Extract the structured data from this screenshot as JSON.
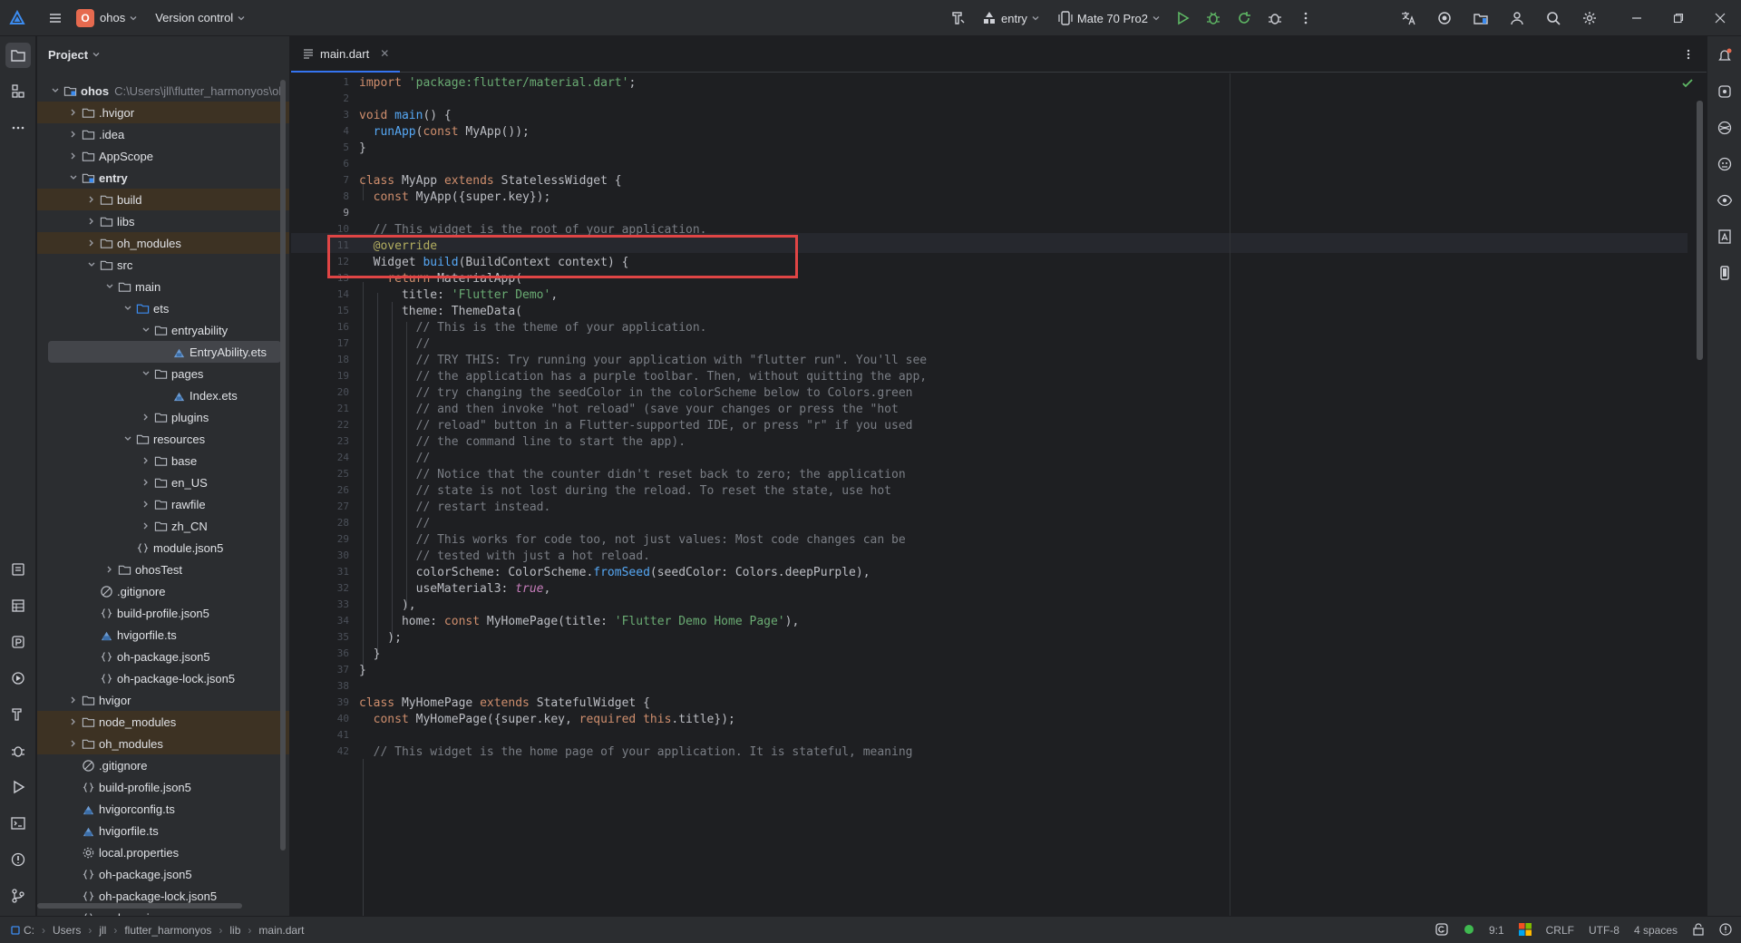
{
  "titlebar": {
    "project_badge": "O",
    "project_name": "ohos",
    "vcs_label": "Version control",
    "run_config": "entry",
    "device": "Mate 70 Pro2"
  },
  "project_panel": {
    "title": "Project",
    "root_name": "ohos",
    "root_path": "C:\\Users\\jll\\flutter_harmonyos\\oh",
    "items": [
      {
        "label": ".hvigor"
      },
      {
        "label": ".idea"
      },
      {
        "label": "AppScope"
      },
      {
        "label": "entry"
      },
      {
        "label": "build"
      },
      {
        "label": "libs"
      },
      {
        "label": "oh_modules"
      },
      {
        "label": "src"
      },
      {
        "label": "main"
      },
      {
        "label": "ets"
      },
      {
        "label": "entryability"
      },
      {
        "label": "EntryAbility.ets"
      },
      {
        "label": "pages"
      },
      {
        "label": "Index.ets"
      },
      {
        "label": "plugins"
      },
      {
        "label": "resources"
      },
      {
        "label": "base"
      },
      {
        "label": "en_US"
      },
      {
        "label": "rawfile"
      },
      {
        "label": "zh_CN"
      },
      {
        "label": "module.json5"
      },
      {
        "label": "ohosTest"
      },
      {
        "label": ".gitignore"
      },
      {
        "label": "build-profile.json5"
      },
      {
        "label": "hvigorfile.ts"
      },
      {
        "label": "oh-package.json5"
      },
      {
        "label": "oh-package-lock.json5"
      },
      {
        "label": "hvigor"
      },
      {
        "label": "node_modules"
      },
      {
        "label": "oh_modules"
      },
      {
        "label": ".gitignore"
      },
      {
        "label": "build-profile.json5"
      },
      {
        "label": "hvigorconfig.ts"
      },
      {
        "label": "hvigorfile.ts"
      },
      {
        "label": "local.properties"
      },
      {
        "label": "oh-package.json5"
      },
      {
        "label": "oh-package-lock.json5"
      },
      {
        "label": "package.json"
      }
    ]
  },
  "editor": {
    "tab_label": "main.dart",
    "line_numbers": [
      "1",
      "2",
      "3",
      "4",
      "5",
      "6",
      "7",
      "8",
      "9",
      "10",
      "11",
      "12",
      "13",
      "14",
      "15",
      "16",
      "17",
      "18",
      "19",
      "20",
      "21",
      "22",
      "23",
      "24",
      "25",
      "26",
      "27",
      "28",
      "29",
      "30",
      "31",
      "32",
      "33",
      "34",
      "35",
      "36",
      "37",
      "38",
      "39",
      "40",
      "41",
      "42"
    ],
    "code": {
      "l1a": "import ",
      "l1b": "'package:flutter/material.dart'",
      "l1c": ";",
      "l3a": "void ",
      "l3b": "main",
      "l3c": "() {",
      "l4a": "  ",
      "l4b": "runApp",
      "l4c": "(",
      "l4d": "const ",
      "l4e": "MyApp());",
      "l5": "}",
      "l7a": "class ",
      "l7b": "MyApp ",
      "l7c": "extends ",
      "l7d": "StatelessWidget {",
      "l8a": "  ",
      "l8b": "const ",
      "l8c": "MyApp({super.key});",
      "l10": "  // This widget is the root of your application.",
      "l11": "  @override",
      "l12a": "  Widget ",
      "l12b": "build",
      "l12c": "(BuildContext context) {",
      "l13a": "    ",
      "l13b": "return ",
      "l13c": "MaterialApp(",
      "l14a": "      title: ",
      "l14b": "'Flutter Demo'",
      "l14c": ",",
      "l15": "      theme: ThemeData(",
      "l16": "        // This is the theme of your application.",
      "l17": "        //",
      "l18": "        // TRY THIS: Try running your application with \"flutter run\". You'll see",
      "l19": "        // the application has a purple toolbar. Then, without quitting the app,",
      "l20": "        // try changing the seedColor in the colorScheme below to Colors.green",
      "l21": "        // and then invoke \"hot reload\" (save your changes or press the \"hot",
      "l22": "        // reload\" button in a Flutter-supported IDE, or press \"r\" if you used",
      "l23": "        // the command line to start the app).",
      "l24": "        //",
      "l25": "        // Notice that the counter didn't reset back to zero; the application",
      "l26": "        // state is not lost during the reload. To reset the state, use hot",
      "l27": "        // restart instead.",
      "l28": "        //",
      "l29": "        // This works for code too, not just values: Most code changes can be",
      "l30": "        // tested with just a hot reload.",
      "l31a": "        colorScheme: ColorScheme.",
      "l31b": "fromSeed",
      "l31c": "(seedColor: Colors.deepPurple),",
      "l32a": "        useMaterial3: ",
      "l32b": "true",
      "l32c": ",",
      "l33": "      ),",
      "l34a": "      home: ",
      "l34b": "const ",
      "l34c": "MyHomePage(title: ",
      "l34d": "'Flutter Demo Home Page'",
      "l34e": "),",
      "l35": "    );",
      "l36": "  }",
      "l37": "}",
      "l39a": "class ",
      "l39b": "MyHomePage ",
      "l39c": "extends ",
      "l39d": "StatefulWidget {",
      "l40a": "  ",
      "l40b": "const ",
      "l40c": "MyHomePage({super.key, ",
      "l40d": "required ",
      "l40e": "this",
      "l40f": ".title});",
      "l42": "  // This widget is the home page of your application. It is stateful, meaning"
    }
  },
  "statusbar": {
    "crumbs": [
      "C:",
      "Users",
      "jll",
      "flutter_harmonyos",
      "lib",
      "main.dart"
    ],
    "position": "9:1",
    "line_sep": "CRLF",
    "encoding": "UTF-8",
    "indent": "4 spaces"
  },
  "colors": {
    "accent": "#3574f0",
    "highlight_box": "#e04545",
    "keyword": "#cf8e6d",
    "string": "#6aab73",
    "comment": "#7a7e85"
  }
}
